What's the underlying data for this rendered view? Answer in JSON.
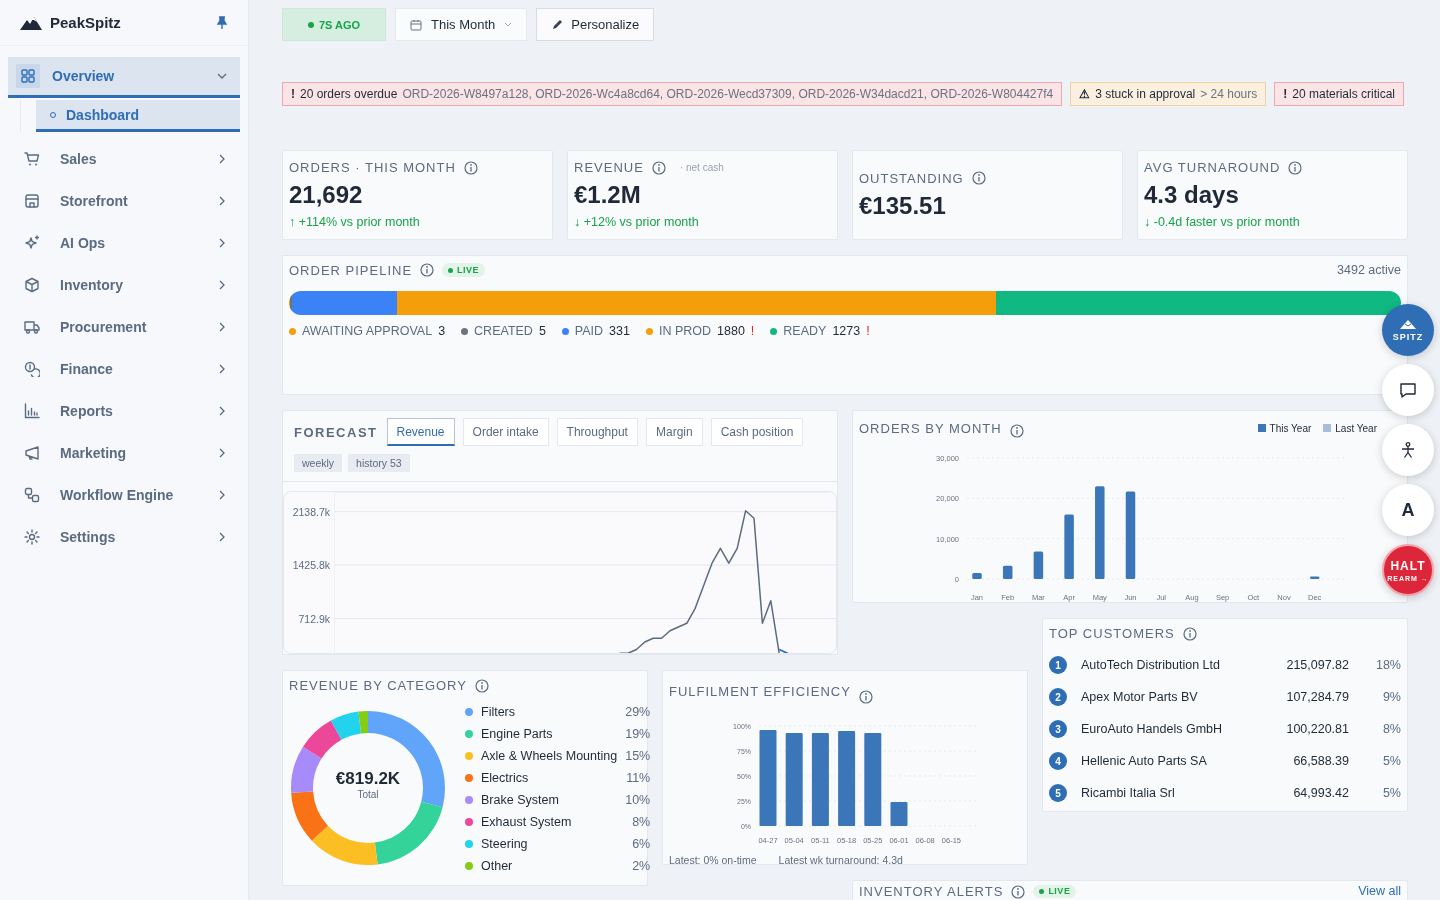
{
  "sidebar": {
    "brand": "PeakSpitz",
    "items": [
      {
        "label": "Overview",
        "selected": true,
        "expanded": true,
        "children": [
          {
            "label": "Dashboard",
            "selected": true
          }
        ]
      },
      {
        "label": "Sales",
        "selected": false,
        "expanded": false
      },
      {
        "label": "Storefront",
        "selected": false,
        "expanded": false
      },
      {
        "label": "AI Ops",
        "selected": false,
        "expanded": false
      },
      {
        "label": "Inventory",
        "selected": false,
        "expanded": false
      },
      {
        "label": "Procurement",
        "selected": false,
        "expanded": false
      },
      {
        "label": "Finance",
        "selected": false,
        "expanded": false
      },
      {
        "label": "Reports",
        "selected": false,
        "expanded": false
      },
      {
        "label": "Marketing",
        "selected": false,
        "expanded": false
      },
      {
        "label": "Workflow Engine",
        "selected": false,
        "expanded": false
      },
      {
        "label": "Settings",
        "selected": false,
        "expanded": false
      }
    ]
  },
  "toolbar": {
    "status": {
      "label": "7S AGO",
      "live": true
    },
    "period": {
      "label": "This Month"
    },
    "personalize": {
      "label": "Personalize"
    }
  },
  "alerts": [
    {
      "kind": "error",
      "icon": "!",
      "title": "20 orders overdue",
      "detail": "ORD-2026-W8497a128, ORD-2026-Wc4a8cd64, ORD-2026-Wecd37309, ORD-2026-W34dacd21, ORD-2026-W804427f4"
    },
    {
      "kind": "warning",
      "icon": "⚠",
      "title": "3 stuck in approval",
      "detail": "> 24 hours"
    },
    {
      "kind": "error",
      "icon": "!",
      "title": "20 materials critical"
    }
  ],
  "kpis": [
    {
      "label": "ORDERS · THIS MONTH",
      "value": "21,692",
      "delta": "↑ +114% vs prior month"
    },
    {
      "label": "REVENUE",
      "note": "· net cash",
      "value": "€1.2M",
      "delta": "↓ +12% vs prior month"
    },
    {
      "label": "OUTSTANDING",
      "value": "€135.51"
    },
    {
      "label": "AVG TURNAROUND",
      "value": "4.3 days",
      "delta": "↓ -0.4d faster vs prior month"
    }
  ],
  "pipeline": {
    "title": "ORDER PIPELINE",
    "badge": "LIVE",
    "total": "3492 active",
    "stages": [
      {
        "label": "AWAITING APPROVAL",
        "count": "3",
        "color": "#f59e0b"
      },
      {
        "label": "CREATED",
        "count": "5",
        "color": "#6b7280"
      },
      {
        "label": "PAID",
        "count": "331",
        "color": "#3b82f6"
      },
      {
        "label": "IN PROD",
        "count": "1880",
        "color": "#f59e0b",
        "flag": "!"
      },
      {
        "label": "READY",
        "count": "1273",
        "color": "#10b981",
        "flag": "!"
      }
    ]
  },
  "forecast": {
    "title": "FORECAST",
    "tabs": [
      {
        "label": "Revenue",
        "selected": true
      },
      {
        "label": "Order intake",
        "selected": false
      },
      {
        "label": "Throughput",
        "selected": false
      },
      {
        "label": "Margin",
        "selected": false
      },
      {
        "label": "Cash position",
        "selected": false
      }
    ],
    "chips": [
      "weekly",
      "history 53"
    ],
    "chart_data": {
      "type": "line",
      "grid": true,
      "ylim": [
        200,
        2400
      ],
      "yticks": [
        {
          "value": 712.9,
          "label": "712.9k"
        },
        {
          "value": 1425.8,
          "label": "1425.8k"
        },
        {
          "value": 2138.7,
          "label": "2138.7k"
        }
      ],
      "series": [
        {
          "color": "#5b6b82",
          "values": [
            null,
            null,
            null,
            null,
            null,
            null,
            null,
            null,
            null,
            null,
            null,
            null,
            null,
            null,
            null,
            null,
            null,
            null,
            null,
            null,
            null,
            null,
            null,
            null,
            null,
            null,
            null,
            null,
            null,
            null,
            null,
            null,
            null,
            null,
            250,
            250,
            300,
            400,
            450,
            450,
            550,
            600,
            650,
            850,
            1150,
            1450,
            1650,
            1450,
            1650,
            2150,
            2050,
            650,
            950,
            250,
            null,
            null,
            null,
            null,
            null,
            null,
            null
          ]
        },
        {
          "color": "#2f6db5",
          "values": [
            null,
            null,
            null,
            null,
            null,
            null,
            null,
            null,
            null,
            null,
            null,
            null,
            null,
            null,
            null,
            null,
            null,
            null,
            null,
            null,
            null,
            null,
            null,
            null,
            null,
            null,
            null,
            null,
            null,
            null,
            null,
            null,
            null,
            null,
            null,
            null,
            null,
            null,
            null,
            null,
            null,
            null,
            null,
            null,
            null,
            null,
            null,
            null,
            null,
            null,
            null,
            null,
            null,
            300,
            250,
            null,
            null,
            null,
            null,
            null,
            null
          ]
        }
      ]
    }
  },
  "orders_by_month": {
    "title": "ORDERS BY MONTH",
    "chart_data": {
      "type": "bar",
      "grid": true,
      "legend": "top-right",
      "categories": [
        "Jan",
        "Feb",
        "Mar",
        "Apr",
        "May",
        "Jun",
        "Jul",
        "Aug",
        "Sep",
        "Oct",
        "Nov",
        "Dec"
      ],
      "ylim": [
        0,
        30000
      ],
      "yticks": [
        {
          "value": 0,
          "label": "0"
        },
        {
          "value": 10000,
          "label": "10,000"
        },
        {
          "value": 20000,
          "label": "20,000"
        },
        {
          "value": 30000,
          "label": "30,000"
        }
      ],
      "series": [
        {
          "name": "This Year",
          "color": "#3b76b8",
          "values": [
            1500,
            3300,
            6800,
            16000,
            23000,
            21700,
            null,
            null,
            null,
            null,
            null,
            600
          ]
        },
        {
          "name": "Last Year",
          "color": "#a7bddb",
          "values": [
            null,
            null,
            null,
            null,
            null,
            null,
            null,
            null,
            null,
            null,
            null,
            null
          ]
        }
      ]
    }
  },
  "top_customers": {
    "title": "TOP CUSTOMERS",
    "rows": [
      {
        "rank": "1",
        "name": "AutoTech Distribution Ltd",
        "amount": "215,097.82",
        "share": "18%"
      },
      {
        "rank": "2",
        "name": "Apex Motor Parts BV",
        "amount": "107,284.79",
        "share": "9%"
      },
      {
        "rank": "3",
        "name": "EuroAuto Handels GmbH",
        "amount": "100,220.81",
        "share": "8%"
      },
      {
        "rank": "4",
        "name": "Hellenic Auto Parts SA",
        "amount": "66,588.39",
        "share": "5%"
      },
      {
        "rank": "5",
        "name": "Ricambi Italia Srl",
        "amount": "64,993.42",
        "share": "5%"
      }
    ]
  },
  "revenue_by_category": {
    "title": "REVENUE BY CATEGORY",
    "total": "€819.2K",
    "total_label": "Total",
    "chart_data": {
      "type": "donut",
      "categories": [
        "Filters",
        "Engine Parts",
        "Axle & Wheels Mounting",
        "Electrics",
        "Brake System",
        "Exhaust System",
        "Steering",
        "Other"
      ],
      "values": [
        29,
        19,
        15,
        11,
        10,
        8,
        6,
        2
      ],
      "value_labels": [
        "29%",
        "19%",
        "15%",
        "11%",
        "10%",
        "8%",
        "6%",
        "2%"
      ],
      "colors": [
        "#60a5fa",
        "#34d399",
        "#fbbf24",
        "#f97316",
        "#a78bfa",
        "#ec4899",
        "#22d3ee",
        "#84cc16"
      ]
    }
  },
  "fulfilment": {
    "title": "FULFILMENT EFFICIENCY",
    "footer": [
      "Latest: 0% on-time",
      "Latest wk turnaround: 4.3d"
    ],
    "chart_data": {
      "type": "bar",
      "categories": [
        "04-27",
        "05-04",
        "05-11",
        "05-18",
        "05-25",
        "06-01",
        "06-08",
        "06-15"
      ],
      "values": [
        96,
        93,
        93,
        95,
        93,
        24,
        null,
        null
      ],
      "grid": true,
      "ylim": [
        0,
        100
      ],
      "yticks": [
        {
          "value": 0,
          "label": "0%"
        },
        {
          "value": 25,
          "label": "25%"
        },
        {
          "value": 50,
          "label": "50%"
        },
        {
          "value": 75,
          "label": "75%"
        },
        {
          "value": 100,
          "label": "100%"
        }
      ]
    }
  },
  "inventory_alerts": {
    "title": "INVENTORY ALERTS",
    "badge": "LIVE",
    "link": "View all"
  },
  "floating_actions": [
    {
      "kind": "brand",
      "label": "SPITZ"
    },
    {
      "kind": "chat"
    },
    {
      "kind": "accessibility"
    },
    {
      "kind": "text",
      "label": "A"
    },
    {
      "kind": "halt",
      "label": "HALT",
      "sublabel": "REARM →"
    }
  ]
}
